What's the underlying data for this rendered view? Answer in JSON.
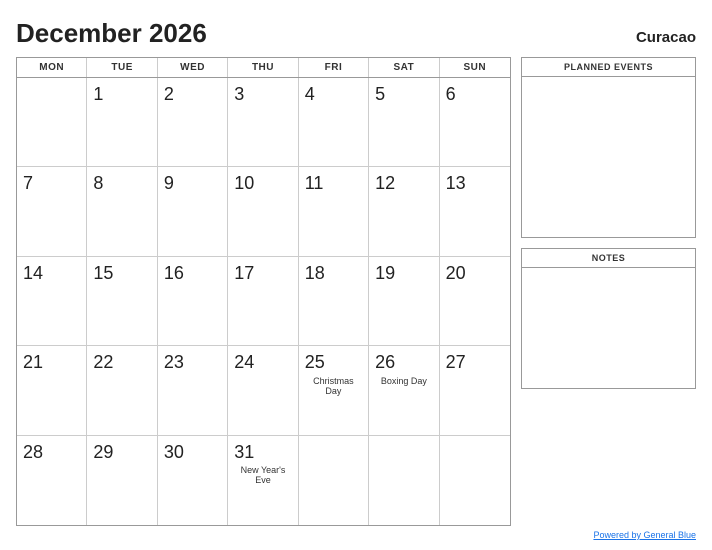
{
  "header": {
    "title": "December 2026",
    "region": "Curacao"
  },
  "day_headers": [
    "MON",
    "TUE",
    "WED",
    "THU",
    "FRI",
    "SAT",
    "SUN"
  ],
  "weeks": [
    [
      {
        "num": "",
        "empty": true
      },
      {
        "num": "1",
        "empty": false
      },
      {
        "num": "2",
        "empty": false
      },
      {
        "num": "3",
        "empty": false
      },
      {
        "num": "4",
        "empty": false
      },
      {
        "num": "5",
        "empty": false
      },
      {
        "num": "6",
        "empty": false
      }
    ],
    [
      {
        "num": "7",
        "empty": false
      },
      {
        "num": "8",
        "empty": false
      },
      {
        "num": "9",
        "empty": false
      },
      {
        "num": "10",
        "empty": false
      },
      {
        "num": "11",
        "empty": false
      },
      {
        "num": "12",
        "empty": false
      },
      {
        "num": "13",
        "empty": false
      }
    ],
    [
      {
        "num": "14",
        "empty": false
      },
      {
        "num": "15",
        "empty": false
      },
      {
        "num": "16",
        "empty": false
      },
      {
        "num": "17",
        "empty": false
      },
      {
        "num": "18",
        "empty": false
      },
      {
        "num": "19",
        "empty": false
      },
      {
        "num": "20",
        "empty": false
      }
    ],
    [
      {
        "num": "21",
        "empty": false
      },
      {
        "num": "22",
        "empty": false
      },
      {
        "num": "23",
        "empty": false
      },
      {
        "num": "24",
        "empty": false
      },
      {
        "num": "25",
        "empty": false,
        "event": "Christmas Day"
      },
      {
        "num": "26",
        "empty": false,
        "event": "Boxing Day"
      },
      {
        "num": "27",
        "empty": false
      }
    ],
    [
      {
        "num": "28",
        "empty": false,
        "last": true
      },
      {
        "num": "29",
        "empty": false,
        "last": true
      },
      {
        "num": "30",
        "empty": false,
        "last": true
      },
      {
        "num": "31",
        "empty": false,
        "last": true,
        "event": "New Year's Eve"
      },
      {
        "num": "",
        "empty": true,
        "last": true
      },
      {
        "num": "",
        "empty": true,
        "last": true
      },
      {
        "num": "",
        "empty": true,
        "last": true
      }
    ]
  ],
  "sidebar": {
    "planned_events_label": "PLANNED EVENTS",
    "notes_label": "NOTES"
  },
  "footer": {
    "link_text": "Powered by General Blue",
    "link_url": "#"
  }
}
